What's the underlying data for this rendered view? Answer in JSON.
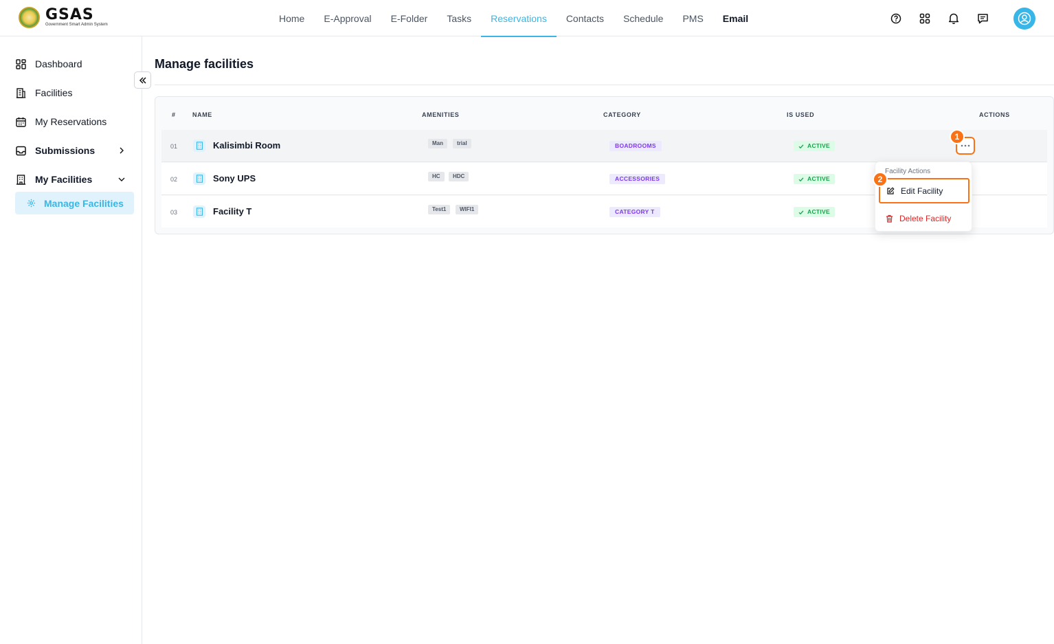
{
  "header": {
    "brand_name": "GSAS",
    "brand_subtitle": "Government Smart Admin System",
    "nav": [
      {
        "label": "Home"
      },
      {
        "label": "E-Approval"
      },
      {
        "label": "E-Folder"
      },
      {
        "label": "Tasks"
      },
      {
        "label": "Reservations",
        "active": true
      },
      {
        "label": "Contacts"
      },
      {
        "label": "Schedule"
      },
      {
        "label": "PMS"
      },
      {
        "label": "Email"
      }
    ],
    "icons": [
      "help-icon",
      "apps-grid-icon",
      "bell-icon",
      "chat-icon",
      "user-avatar-icon"
    ]
  },
  "sidebar": {
    "items": [
      {
        "label": "Dashboard",
        "icon": "dashboard-icon"
      },
      {
        "label": "Facilities",
        "icon": "building-icon"
      },
      {
        "label": "My Reservations",
        "icon": "calendar-icon"
      },
      {
        "label": "Submissions",
        "icon": "inbox-icon"
      },
      {
        "label": "My Facilities",
        "icon": "building-icon"
      },
      {
        "label": "Manage Facilities",
        "icon": "gear-icon",
        "active": true
      }
    ]
  },
  "main": {
    "title": "Manage facilities",
    "table": {
      "headers": [
        "#",
        "NAME",
        "AMENITIES",
        "CATEGORY",
        "IS USED",
        "ACTIONS"
      ],
      "rows": [
        {
          "num": "01",
          "name": "Kalisimbi Room",
          "amenities": [
            "Man",
            "trial"
          ],
          "category": "BOADROOMS",
          "status": "ACTIVE"
        },
        {
          "num": "02",
          "name": "Sony UPS",
          "amenities": [
            "HC",
            "HDC"
          ],
          "category": "ACCESSORIES",
          "status": "ACTIVE"
        },
        {
          "num": "03",
          "name": "Facility T",
          "amenities": [
            "Test1",
            "WIFI1"
          ],
          "category": "CATEGORY T",
          "status": "ACTIVE"
        }
      ]
    },
    "actions_menu": {
      "title": "Facility Actions",
      "edit_label": "Edit Facility",
      "delete_label": "Delete Facility"
    },
    "step_badges": [
      "1",
      "2"
    ]
  },
  "colors": {
    "accent": "#38b6e8",
    "highlight": "#f97316",
    "danger": "#dc2626",
    "success": "#16a34a",
    "category": "#7c3aed"
  }
}
